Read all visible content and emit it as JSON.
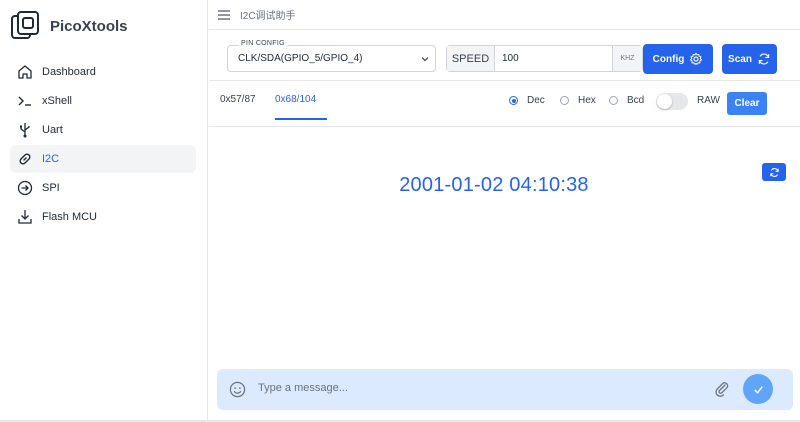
{
  "app": {
    "name": "PicoXtools"
  },
  "sidebar": {
    "items": [
      {
        "label": "Dashboard",
        "icon": "home-icon",
        "active": false
      },
      {
        "label": "xShell",
        "icon": "terminal-icon",
        "active": false
      },
      {
        "label": "Uart",
        "icon": "usb-icon",
        "active": false
      },
      {
        "label": "I2C",
        "icon": "link-icon",
        "active": true
      },
      {
        "label": "SPI",
        "icon": "arrow-circle-icon",
        "active": false
      },
      {
        "label": "Flash MCU",
        "icon": "download-icon",
        "active": false
      }
    ]
  },
  "topbar": {
    "title": "I2C调试助手",
    "menu_icon": "hamburger-icon"
  },
  "config": {
    "pin_label": "PIN CONFIG",
    "pin_value": "CLK/SDA(GPIO_5/GPIO_4)",
    "speed_prefix": "SPEED",
    "speed_value": "100",
    "speed_unit": "KHZ",
    "config_button": "Config",
    "scan_button": "Scan"
  },
  "tabs": [
    {
      "label": "0x57/87",
      "active": false
    },
    {
      "label": "0x68/104",
      "active": true
    }
  ],
  "format": {
    "dec": "Dec",
    "hex": "Hex",
    "bcd": "Bcd",
    "selected": "Dec",
    "raw_label": "RAW",
    "raw_enabled": false,
    "clear_button": "Clear"
  },
  "display": {
    "datetime": "2001-01-02 04:10:38"
  },
  "composer": {
    "placeholder": "Type a message..."
  },
  "colors": {
    "accent": "#2563eb",
    "composer_bg": "#dbeafe",
    "send": "#60a5fa"
  }
}
